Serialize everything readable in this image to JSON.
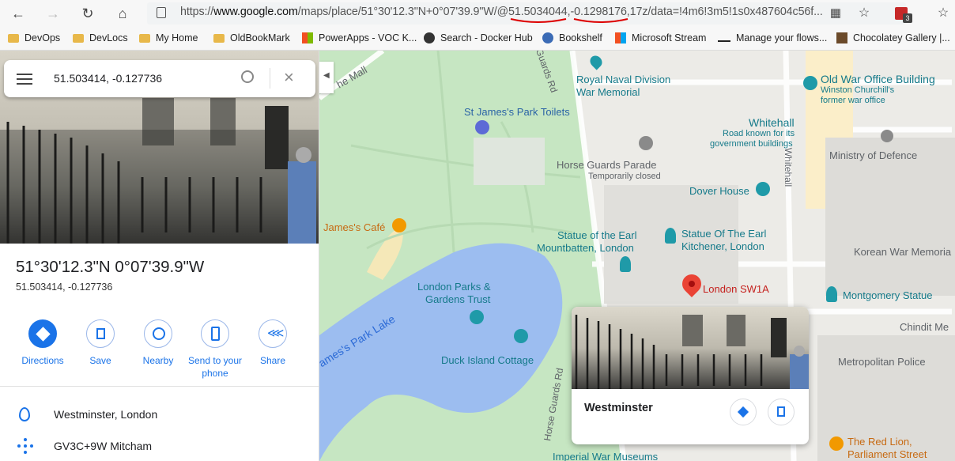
{
  "browser": {
    "url_prefix": "https://",
    "url_host": "www.google.com",
    "url_rest": "/maps/place/51°30'12.3\"N+0°07'39.9\"W/@51.5034044,-0.1298176,17z/data=!4m6!3m5!1s0x487604c56f...",
    "ext_badge": "3"
  },
  "bookmarks": [
    {
      "label": "DevOps",
      "icon": "folder-icon"
    },
    {
      "label": "DevLocs",
      "icon": "folder-icon"
    },
    {
      "label": "My Home",
      "icon": "folder-icon"
    },
    {
      "label": "OldBookMark",
      "icon": "folder-icon"
    },
    {
      "label": "PowerApps - VOC K...",
      "icon": "microsoft-icon"
    },
    {
      "label": "Search - Docker Hub",
      "icon": "docker-icon"
    },
    {
      "label": "Bookshelf",
      "icon": "bookshelf-icon"
    },
    {
      "label": "Microsoft Stream",
      "icon": "microsoft-icon"
    },
    {
      "label": "Manage your flows...",
      "icon": "flow-icon"
    },
    {
      "label": "Chocolatey Gallery |...",
      "icon": "chocolatey-icon"
    }
  ],
  "panel": {
    "search_value": "51.503414, -0.127736",
    "title": "51°30'12.3\"N 0°07'39.9\"W",
    "subtitle": "51.503414, -0.127736",
    "actions": [
      {
        "label": "Directions",
        "icon": "directions-icon"
      },
      {
        "label": "Save",
        "icon": "bookmark-icon"
      },
      {
        "label": "Nearby",
        "icon": "nearby-icon"
      },
      {
        "label": "Send to your phone",
        "icon": "phone-icon"
      },
      {
        "label": "Share",
        "icon": "share-icon"
      }
    ],
    "address": "Westminster, London",
    "pluscode": "GV3C+9W Mitcham"
  },
  "map": {
    "labels": {
      "the_mall": "he Mall",
      "horse_guards_rd_top": "Guards Rd",
      "royal_naval": "Royal Naval Division",
      "war_memorial": "War Memorial",
      "old_war_office": "Old War Office Building",
      "churchill1": "Winston Churchill's",
      "churchill2": "former war office",
      "toilets": "St James's Park Toilets",
      "whitehall": "Whitehall",
      "whitehall_sub1": "Road known for its",
      "whitehall_sub2": "government buildings",
      "whitehall_road": "Whitehall",
      "horse_guards_parade": "Horse Guards Parade",
      "temp_closed": "Temporarily closed",
      "ministry": "Ministry of Defence",
      "dover_house": "Dover House",
      "james_cafe": "James's Café",
      "mountbatten1": "Statue of the Earl",
      "mountbatten2": "Mountbatten, London",
      "kitchener1": "Statue Of The Earl",
      "kitchener2": "Kitchener, London",
      "korean": "Korean War Memoria",
      "london_sw1a": "London SW1A",
      "london_parks1": "London Parks &",
      "london_parks2": "Gardens Trust",
      "montgomery": "Montgomery Statue",
      "chindit": "Chindit Me",
      "lake": "ames's Park Lake",
      "duck_island": "Duck Island Cottage",
      "metropolitan": "Metropolitan Police",
      "horse_guards_rd_bottom": "Horse Guards Rd",
      "red_lion1": "The Red Lion,",
      "red_lion2": "Parliament Street",
      "imperial": "Imperial War Museums"
    },
    "card_title": "Westminster"
  }
}
